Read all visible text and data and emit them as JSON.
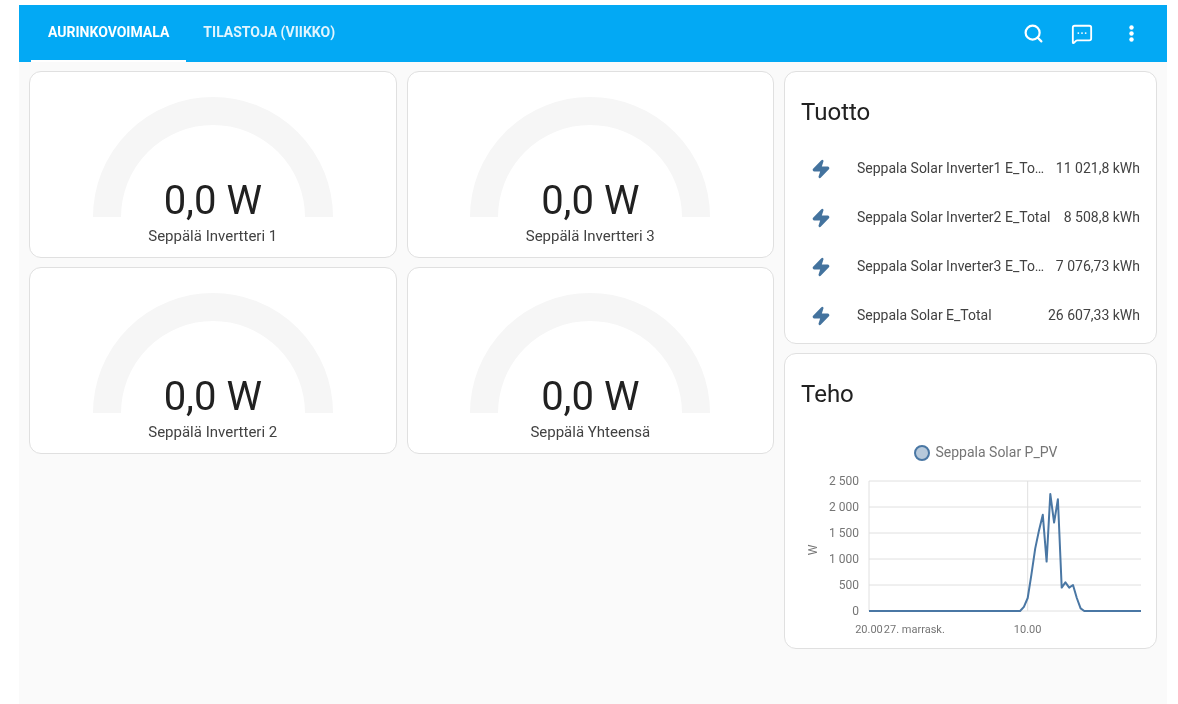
{
  "tabs": [
    {
      "label": "AURINKOVOIMALA",
      "selected": true
    },
    {
      "label": "TILASTOJA (VIIKKO)",
      "selected": false
    }
  ],
  "gauges": [
    [
      {
        "value": "0,0 W",
        "name": "Seppälä Invertteri 1"
      },
      {
        "value": "0,0 W",
        "name": "Seppälä Invertteri 2"
      }
    ],
    [
      {
        "value": "0,0 W",
        "name": "Seppälä Invertteri 3"
      },
      {
        "value": "0,0 W",
        "name": "Seppälä Yhteensä"
      }
    ]
  ],
  "energy_card": {
    "title": "Tuotto",
    "entities": [
      {
        "name": "Seppala Solar Inverter1 E_To…",
        "state": "11 021,8 kWh"
      },
      {
        "name": "Seppala Solar Inverter2 E_Total",
        "state": "8 508,8 kWh"
      },
      {
        "name": "Seppala Solar Inverter3 E_To…",
        "state": "7 076,73 kWh"
      },
      {
        "name": "Seppala Solar E_Total",
        "state": "26 607,33 kWh"
      }
    ]
  },
  "power_card": {
    "title": "Teho",
    "chart_data": {
      "type": "line",
      "ylabel": "W",
      "categories": [
        "20.00",
        null,
        null,
        null,
        null,
        null,
        null,
        null,
        null,
        null,
        null,
        null,
        "27. marrask.",
        null,
        null,
        null,
        null,
        null,
        null,
        null,
        null,
        null,
        null,
        null,
        null,
        null,
        null,
        null,
        null,
        null,
        null,
        null,
        null,
        null,
        null,
        null,
        null,
        null,
        null,
        null,
        null,
        null,
        "10.00",
        null,
        null,
        null,
        null,
        null,
        null,
        null,
        null,
        null,
        null,
        null,
        null,
        null,
        null,
        null,
        null,
        null,
        null,
        null,
        null,
        null,
        null,
        null,
        null,
        null,
        null,
        null,
        null,
        null,
        null
      ],
      "series": [
        {
          "name": "Seppala Solar P_PV",
          "color": "#4a77a4",
          "values": [
            0,
            0,
            0,
            0,
            0,
            0,
            0,
            0,
            0,
            0,
            0,
            0,
            0,
            0,
            0,
            0,
            0,
            0,
            0,
            0,
            0,
            0,
            0,
            0,
            0,
            0,
            0,
            0,
            0,
            0,
            0,
            0,
            0,
            0,
            0,
            0,
            0,
            0,
            0,
            0,
            0,
            80,
            250,
            700,
            1200,
            1550,
            1850,
            950,
            2250,
            1700,
            2150,
            450,
            550,
            450,
            500,
            250,
            50,
            0,
            0,
            0,
            0,
            0,
            0,
            0,
            0,
            0,
            0,
            0,
            0,
            0,
            0,
            0,
            0
          ]
        }
      ],
      "ylim": [
        0,
        2500
      ],
      "grid": true,
      "yticks": [
        {
          "value": 0,
          "label": "0"
        },
        {
          "value": 500,
          "label": "500"
        },
        {
          "value": 1000,
          "label": "1 000"
        },
        {
          "value": 1500,
          "label": "1 500"
        },
        {
          "value": 2000,
          "label": "2 000"
        },
        {
          "value": 2500,
          "label": "2 500"
        }
      ]
    }
  }
}
